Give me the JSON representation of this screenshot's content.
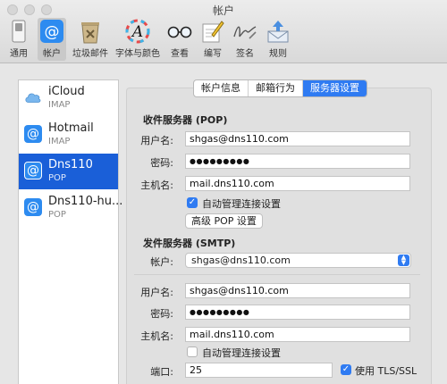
{
  "window": {
    "title": "帐户"
  },
  "toolbar": {
    "items": [
      {
        "label": "通用",
        "icon": "switch-icon"
      },
      {
        "label": "帐户",
        "icon": "at-sign-icon",
        "selected": true
      },
      {
        "label": "垃圾邮件",
        "icon": "trash-bin-icon"
      },
      {
        "label": "字体与颜色",
        "icon": "color-font-icon"
      },
      {
        "label": "查看",
        "icon": "glasses-icon"
      },
      {
        "label": "编写",
        "icon": "pencil-paper-icon"
      },
      {
        "label": "签名",
        "icon": "signature-icon"
      },
      {
        "label": "规则",
        "icon": "rules-envelope-icon"
      }
    ]
  },
  "accounts": [
    {
      "name": "iCloud",
      "type": "IMAP",
      "icon": "cloud-icon"
    },
    {
      "name": "Hotmail",
      "type": "IMAP",
      "icon": "at-sign-icon"
    },
    {
      "name": "Dns110",
      "type": "POP",
      "icon": "at-sign-icon",
      "selected": true
    },
    {
      "name": "Dns110-hu...",
      "type": "POP",
      "icon": "at-sign-icon"
    }
  ],
  "tabs": [
    {
      "label": "帐户信息"
    },
    {
      "label": "邮箱行为"
    },
    {
      "label": "服务器设置",
      "active": true
    }
  ],
  "incoming": {
    "heading": "收件服务器 (POP)",
    "username_label": "用户名:",
    "username": "shgas@dns110.com",
    "password_label": "密码:",
    "password": "●●●●●●●●●",
    "host_label": "主机名:",
    "host": "mail.dns110.com",
    "auto_manage_label": "自动管理连接设置",
    "advanced_button": "高级 POP 设置"
  },
  "outgoing": {
    "heading": "发件服务器 (SMTP)",
    "account_label": "帐户:",
    "account": "shgas@dns110.com",
    "username_label": "用户名:",
    "username": "shgas@dns110.com",
    "password_label": "密码:",
    "password": "●●●●●●●●●",
    "host_label": "主机名:",
    "host": "mail.dns110.com",
    "auto_manage_label": "自动管理连接设置",
    "port_label": "端口:",
    "port": "25",
    "tls_label": "使用 TLS/SSL"
  },
  "colors": {
    "accent": "#2f7bf2",
    "selection": "#1a5fd8"
  }
}
